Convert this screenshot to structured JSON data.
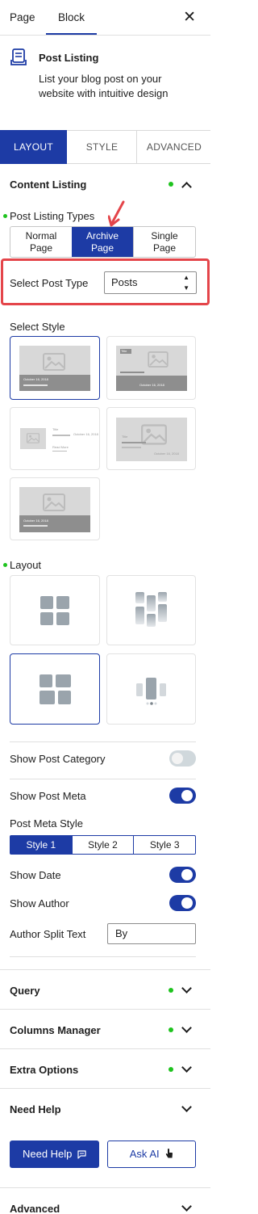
{
  "top_tabs": {
    "page": "Page",
    "block": "Block"
  },
  "block_info": {
    "title": "Post Listing",
    "description": "List your blog post on your website with intuitive design"
  },
  "main_tabs": {
    "layout": "LAYOUT",
    "style": "STYLE",
    "advanced": "ADVANCED"
  },
  "content_listing": {
    "title": "Content Listing",
    "types_label": "Post Listing Types",
    "types": [
      {
        "line1": "Normal",
        "line2": "Page"
      },
      {
        "line1": "Archive",
        "line2": "Page"
      },
      {
        "line1": "Single",
        "line2": "Page"
      }
    ],
    "active_type": "Archive Page",
    "select_post_type_label": "Select Post Type",
    "select_post_type_value": "Posts",
    "select_style_label": "Select Style",
    "thumb_date": "October 16, 2018",
    "thumb_title": "Title",
    "thumb_read_more": "Read More",
    "layout_label": "Layout",
    "show_post_category": "Show Post Category",
    "show_post_category_on": false,
    "show_post_meta": "Show Post Meta",
    "show_post_meta_on": true,
    "post_meta_style_label": "Post Meta Style",
    "meta_styles": [
      "Style 1",
      "Style 2",
      "Style 3"
    ],
    "active_meta_style": "Style 1",
    "show_date": "Show Date",
    "show_date_on": true,
    "show_author": "Show Author",
    "show_author_on": true,
    "author_split_label": "Author Split Text",
    "author_split_value": "By"
  },
  "panels": {
    "query": "Query",
    "columns_manager": "Columns Manager",
    "extra_options": "Extra Options",
    "need_help": "Need Help",
    "advanced": "Advanced"
  },
  "help_buttons": {
    "need_help": "Need Help",
    "ask_ai": "Ask AI"
  },
  "colors": {
    "accent": "#1d3ba5",
    "highlight": "#e4454a",
    "status_dot": "#1ec31e"
  }
}
